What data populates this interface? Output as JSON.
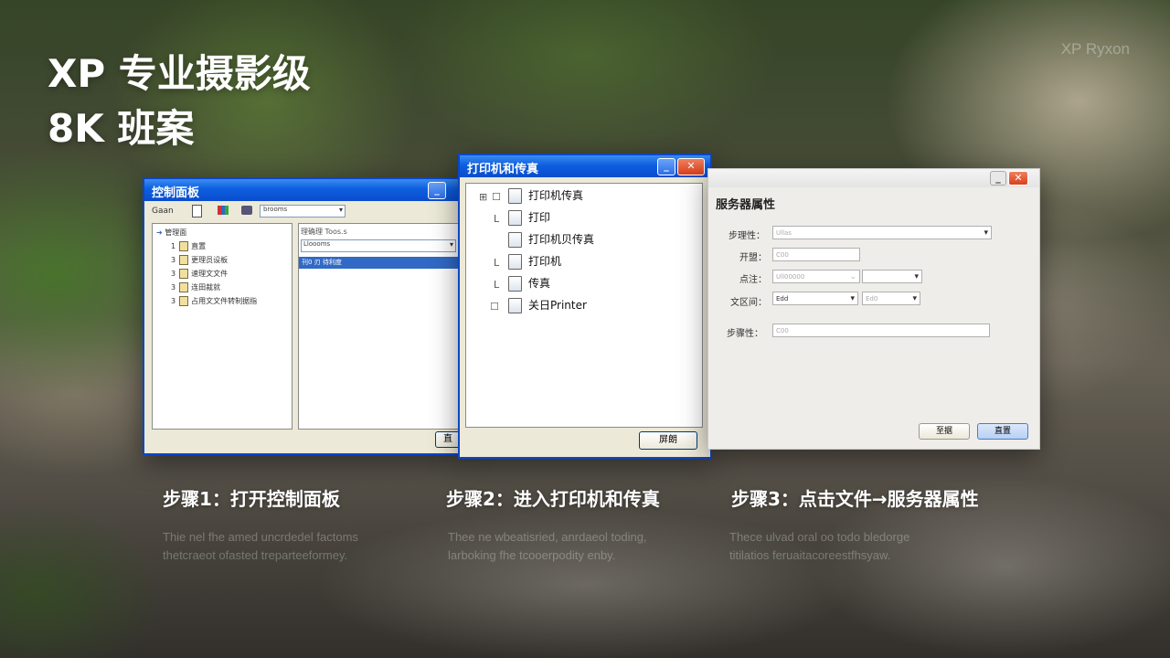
{
  "headline": {
    "line1": "XP 专业摄影级",
    "line2": "8K  班案"
  },
  "brand": "XP Ryxon",
  "window1": {
    "title": "控制面板",
    "toolbar": {
      "back": "Gaan",
      "combo": "brooms"
    },
    "tree": [
      "管理面",
      "直置",
      "更理员设板",
      "速理文文件",
      "连田裁就",
      "占用文文件转制据指"
    ],
    "right_header": "理确理 Toos.s",
    "right_combo": "Lloooms",
    "selected_row": "刊0 刃 待利度",
    "button": "直"
  },
  "window2": {
    "title": "打印机和传真",
    "rows": [
      "打印机传真",
      "打印",
      "打印机贝传真",
      "打印机",
      "传真",
      "关日Printer"
    ],
    "button": "屏朗"
  },
  "window3": {
    "heading": "服务器属性",
    "labels": {
      "l1": "步理性：",
      "l2": "开盟：",
      "l3": "点注：",
      "l4": "文区间：",
      "l5": "步骤性："
    },
    "placeholders": {
      "p1": "Ullas",
      "p2": "C00",
      "p3": "Ull00000",
      "p4": "Edd",
      "p5": "Ed0",
      "p6": "C00"
    },
    "buttons": {
      "cancel": "至据",
      "ok": "直置"
    }
  },
  "steps": [
    {
      "title": "步骤1：打开控制面板",
      "desc1": "Thie nel fhe amed uncrdedel factoms",
      "desc2": "thetcraeot ofasted treparteeformey."
    },
    {
      "title": "步骤2：进入打印机和传真",
      "desc1": "Thee ne wbeatisried, anrdaeol toding,",
      "desc2": "larboking fhe tcooerpodity enby."
    },
    {
      "title": "步骤3：点击文件→服务器属性",
      "desc1": "Thece ulvad oral oo todo bledorge",
      "desc2": "titilatios feruaitacoreestfhsyaw."
    }
  ]
}
